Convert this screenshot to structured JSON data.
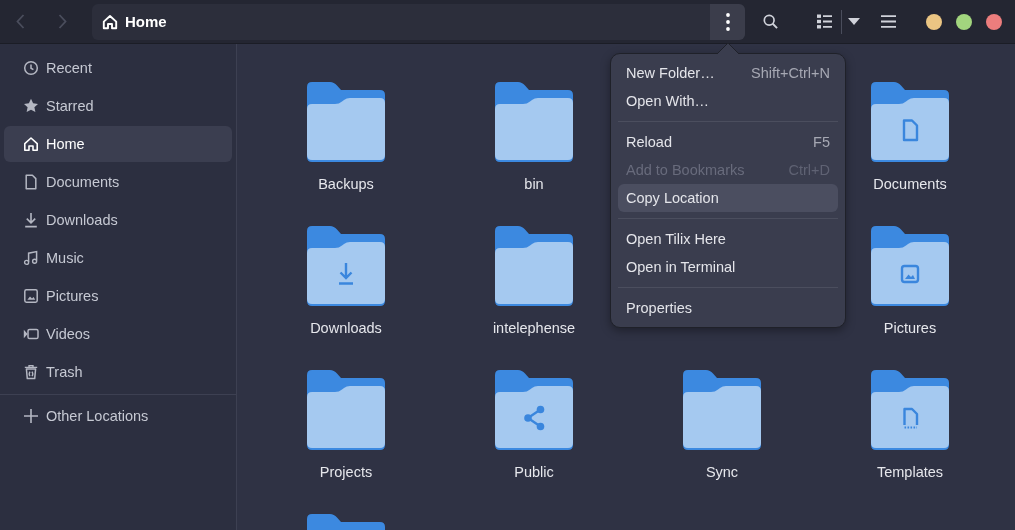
{
  "header": {
    "nav_buttons": [
      {
        "kind": "back",
        "disabled": true
      },
      {
        "kind": "forward",
        "disabled": true
      }
    ],
    "path_bar": {
      "label": "Home"
    },
    "menu_button": {
      "active": true
    },
    "tools": [
      {
        "kind": "search"
      },
      {
        "kind": "view-list"
      },
      {
        "kind": "view-dropdown"
      },
      {
        "kind": "menu"
      }
    ],
    "window_controls": [
      {
        "color": "#ebc583"
      },
      {
        "color": "#a2d57e"
      },
      {
        "color": "#ec7d7d"
      }
    ]
  },
  "sidebar": {
    "places": [
      {
        "kind": "recent",
        "label": "Recent",
        "selected": false
      },
      {
        "kind": "starred",
        "label": "Starred",
        "selected": false
      },
      {
        "kind": "home",
        "label": "Home",
        "selected": true
      },
      {
        "kind": "documents",
        "label": "Documents",
        "selected": false
      },
      {
        "kind": "downloads",
        "label": "Downloads",
        "selected": false
      },
      {
        "kind": "music",
        "label": "Music",
        "selected": false
      },
      {
        "kind": "pictures",
        "label": "Pictures",
        "selected": false
      },
      {
        "kind": "videos",
        "label": "Videos",
        "selected": false
      },
      {
        "kind": "trash",
        "label": "Trash",
        "selected": false
      }
    ],
    "other": [
      {
        "kind": "add",
        "label": "Other Locations",
        "selected": false
      }
    ]
  },
  "grid": {
    "items": [
      {
        "kind": "folder",
        "name": "Backups"
      },
      {
        "kind": "folder",
        "name": "bin"
      },
      {
        "kind": "documents",
        "name": "Documents"
      },
      {
        "kind": "downloads",
        "name": "Downloads"
      },
      {
        "kind": "folder",
        "name": "intelephense"
      },
      {
        "kind": "pictures",
        "name": "Pictures"
      },
      {
        "kind": "folder",
        "name": "Projects"
      },
      {
        "kind": "public",
        "name": "Public"
      },
      {
        "kind": "folder",
        "name": "Sync"
      },
      {
        "kind": "templates",
        "name": "Templates"
      },
      {
        "kind": "folder"
      }
    ]
  },
  "menu": {
    "sections": [
      [
        {
          "label": "New Folder…",
          "shortcut": "Shift+Ctrl+N",
          "disabled": false,
          "highlighted": false
        },
        {
          "label": "Open With…",
          "disabled": false,
          "highlighted": false
        }
      ],
      [
        {
          "label": "Reload",
          "shortcut": "F5",
          "disabled": false,
          "highlighted": false
        },
        {
          "label": "Add to Bookmarks",
          "shortcut": "Ctrl+D",
          "disabled": true,
          "highlighted": false
        },
        {
          "label": "Copy Location",
          "disabled": false,
          "highlighted": true
        }
      ],
      [
        {
          "label": "Open Tilix Here",
          "disabled": false,
          "highlighted": false
        },
        {
          "label": "Open in Terminal",
          "disabled": false,
          "highlighted": false
        }
      ],
      [
        {
          "label": "Properties",
          "disabled": false,
          "highlighted": false
        }
      ]
    ]
  }
}
